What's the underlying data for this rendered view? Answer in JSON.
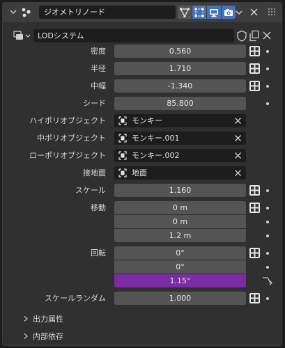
{
  "header": {
    "modifier_name": "ジオメトリノード"
  },
  "datablock": {
    "name": "LODシステム"
  },
  "fields": {
    "density": {
      "label": "密度",
      "value": "0.560"
    },
    "radius": {
      "label": "半径",
      "value": "1.710"
    },
    "width": {
      "label": "中幅",
      "value": "-1.340"
    },
    "seed": {
      "label": "シード",
      "value": "85.800"
    },
    "high_poly": {
      "label": "ハイポリオブジェクト",
      "value": "モンキー"
    },
    "mid_poly": {
      "label": "中ポリオブジェクト",
      "value": "モンキー.001"
    },
    "low_poly": {
      "label": "ローポリオブジェクト",
      "value": "モンキー.002"
    },
    "ground": {
      "label": "接地面",
      "value": "地面"
    },
    "scale": {
      "label": "スケール",
      "value": "1.160"
    },
    "move": {
      "label": "移動",
      "x": "0 m",
      "y": "0 m",
      "z": "1.2 m"
    },
    "rotation": {
      "label": "回転",
      "x": "0°",
      "y": "0°",
      "z": "1.15°"
    },
    "scale_random": {
      "label": "スケールランダム",
      "value": "1.000"
    }
  },
  "subpanels": {
    "output": "出力属性",
    "internal": "内部依存"
  },
  "colors": {
    "field_bg": "#545454",
    "active_toggle": "#4772b3",
    "selected_field": "#7b2ca0"
  }
}
